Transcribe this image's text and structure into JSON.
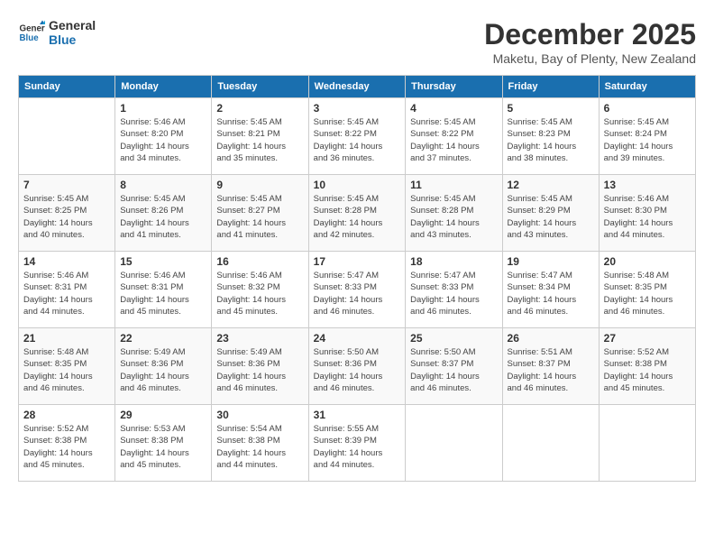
{
  "logo": {
    "line1": "General",
    "line2": "Blue"
  },
  "title": "December 2025",
  "subtitle": "Maketu, Bay of Plenty, New Zealand",
  "headers": [
    "Sunday",
    "Monday",
    "Tuesday",
    "Wednesday",
    "Thursday",
    "Friday",
    "Saturday"
  ],
  "weeks": [
    [
      {
        "day": "",
        "info": ""
      },
      {
        "day": "1",
        "info": "Sunrise: 5:46 AM\nSunset: 8:20 PM\nDaylight: 14 hours\nand 34 minutes."
      },
      {
        "day": "2",
        "info": "Sunrise: 5:45 AM\nSunset: 8:21 PM\nDaylight: 14 hours\nand 35 minutes."
      },
      {
        "day": "3",
        "info": "Sunrise: 5:45 AM\nSunset: 8:22 PM\nDaylight: 14 hours\nand 36 minutes."
      },
      {
        "day": "4",
        "info": "Sunrise: 5:45 AM\nSunset: 8:22 PM\nDaylight: 14 hours\nand 37 minutes."
      },
      {
        "day": "5",
        "info": "Sunrise: 5:45 AM\nSunset: 8:23 PM\nDaylight: 14 hours\nand 38 minutes."
      },
      {
        "day": "6",
        "info": "Sunrise: 5:45 AM\nSunset: 8:24 PM\nDaylight: 14 hours\nand 39 minutes."
      }
    ],
    [
      {
        "day": "7",
        "info": "Sunrise: 5:45 AM\nSunset: 8:25 PM\nDaylight: 14 hours\nand 40 minutes."
      },
      {
        "day": "8",
        "info": "Sunrise: 5:45 AM\nSunset: 8:26 PM\nDaylight: 14 hours\nand 41 minutes."
      },
      {
        "day": "9",
        "info": "Sunrise: 5:45 AM\nSunset: 8:27 PM\nDaylight: 14 hours\nand 41 minutes."
      },
      {
        "day": "10",
        "info": "Sunrise: 5:45 AM\nSunset: 8:28 PM\nDaylight: 14 hours\nand 42 minutes."
      },
      {
        "day": "11",
        "info": "Sunrise: 5:45 AM\nSunset: 8:28 PM\nDaylight: 14 hours\nand 43 minutes."
      },
      {
        "day": "12",
        "info": "Sunrise: 5:45 AM\nSunset: 8:29 PM\nDaylight: 14 hours\nand 43 minutes."
      },
      {
        "day": "13",
        "info": "Sunrise: 5:46 AM\nSunset: 8:30 PM\nDaylight: 14 hours\nand 44 minutes."
      }
    ],
    [
      {
        "day": "14",
        "info": "Sunrise: 5:46 AM\nSunset: 8:31 PM\nDaylight: 14 hours\nand 44 minutes."
      },
      {
        "day": "15",
        "info": "Sunrise: 5:46 AM\nSunset: 8:31 PM\nDaylight: 14 hours\nand 45 minutes."
      },
      {
        "day": "16",
        "info": "Sunrise: 5:46 AM\nSunset: 8:32 PM\nDaylight: 14 hours\nand 45 minutes."
      },
      {
        "day": "17",
        "info": "Sunrise: 5:47 AM\nSunset: 8:33 PM\nDaylight: 14 hours\nand 46 minutes."
      },
      {
        "day": "18",
        "info": "Sunrise: 5:47 AM\nSunset: 8:33 PM\nDaylight: 14 hours\nand 46 minutes."
      },
      {
        "day": "19",
        "info": "Sunrise: 5:47 AM\nSunset: 8:34 PM\nDaylight: 14 hours\nand 46 minutes."
      },
      {
        "day": "20",
        "info": "Sunrise: 5:48 AM\nSunset: 8:35 PM\nDaylight: 14 hours\nand 46 minutes."
      }
    ],
    [
      {
        "day": "21",
        "info": "Sunrise: 5:48 AM\nSunset: 8:35 PM\nDaylight: 14 hours\nand 46 minutes."
      },
      {
        "day": "22",
        "info": "Sunrise: 5:49 AM\nSunset: 8:36 PM\nDaylight: 14 hours\nand 46 minutes."
      },
      {
        "day": "23",
        "info": "Sunrise: 5:49 AM\nSunset: 8:36 PM\nDaylight: 14 hours\nand 46 minutes."
      },
      {
        "day": "24",
        "info": "Sunrise: 5:50 AM\nSunset: 8:36 PM\nDaylight: 14 hours\nand 46 minutes."
      },
      {
        "day": "25",
        "info": "Sunrise: 5:50 AM\nSunset: 8:37 PM\nDaylight: 14 hours\nand 46 minutes."
      },
      {
        "day": "26",
        "info": "Sunrise: 5:51 AM\nSunset: 8:37 PM\nDaylight: 14 hours\nand 46 minutes."
      },
      {
        "day": "27",
        "info": "Sunrise: 5:52 AM\nSunset: 8:38 PM\nDaylight: 14 hours\nand 45 minutes."
      }
    ],
    [
      {
        "day": "28",
        "info": "Sunrise: 5:52 AM\nSunset: 8:38 PM\nDaylight: 14 hours\nand 45 minutes."
      },
      {
        "day": "29",
        "info": "Sunrise: 5:53 AM\nSunset: 8:38 PM\nDaylight: 14 hours\nand 45 minutes."
      },
      {
        "day": "30",
        "info": "Sunrise: 5:54 AM\nSunset: 8:38 PM\nDaylight: 14 hours\nand 44 minutes."
      },
      {
        "day": "31",
        "info": "Sunrise: 5:55 AM\nSunset: 8:39 PM\nDaylight: 14 hours\nand 44 minutes."
      },
      {
        "day": "",
        "info": ""
      },
      {
        "day": "",
        "info": ""
      },
      {
        "day": "",
        "info": ""
      }
    ]
  ]
}
